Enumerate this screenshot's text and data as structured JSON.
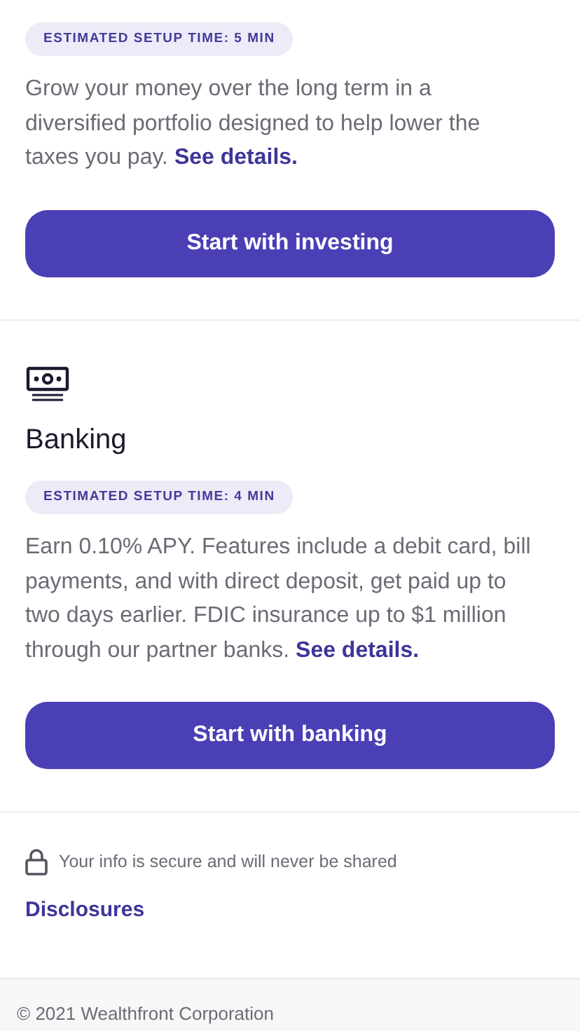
{
  "products": [
    {
      "badge": "ESTIMATED SETUP TIME: 5 MIN",
      "description": "Grow your money over the long term in a diversified portfolio designed to help lower the taxes you pay.",
      "link": "See details.",
      "button": "Start with investing"
    },
    {
      "title": "Banking",
      "badge": "ESTIMATED SETUP TIME: 4 MIN",
      "description": "Earn 0.10% APY. Features include a debit card, bill payments, and with direct deposit, get paid up to two days earlier. FDIC insurance up to $1 million through our partner banks.",
      "link": "See details.",
      "button": "Start with banking"
    }
  ],
  "security_note": "Your info is secure and will never be shared",
  "disclosures_link": "Disclosures",
  "footer": "© 2021 Wealthfront Corporation"
}
